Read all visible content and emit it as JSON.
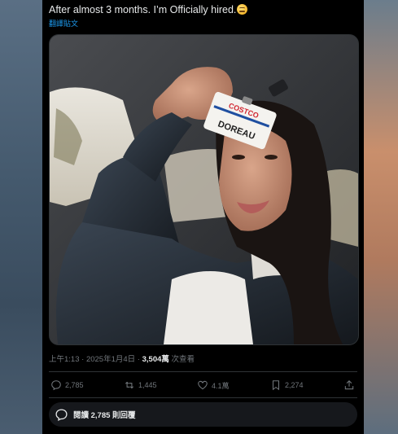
{
  "post": {
    "text": "After almost 3 months. I’m Officially hired.",
    "emoji": "sweat-smile-emoji",
    "translate_link": "翻譯貼文"
  },
  "media": {
    "alt_icon": "photo-selfie",
    "badge": {
      "brand": "COSTCO",
      "name": "DOREAU"
    }
  },
  "meta": {
    "time": "上午1:13",
    "separator1": " · ",
    "date": "2025年1月4日",
    "separator2": " · ",
    "views": "3,504萬",
    "views_label": " 次查看"
  },
  "actions": {
    "reply_count": "2,785",
    "retweet_count": "1,445",
    "like_count": "4.1萬",
    "bookmark_count": "2,274"
  },
  "read_replies": {
    "label": "閱讀 2,785 則回覆"
  },
  "colors": {
    "background": "#000000",
    "text": "#e7e9ea",
    "muted": "#71767b",
    "link": "#1d9bf0",
    "divider": "#2f3336"
  }
}
